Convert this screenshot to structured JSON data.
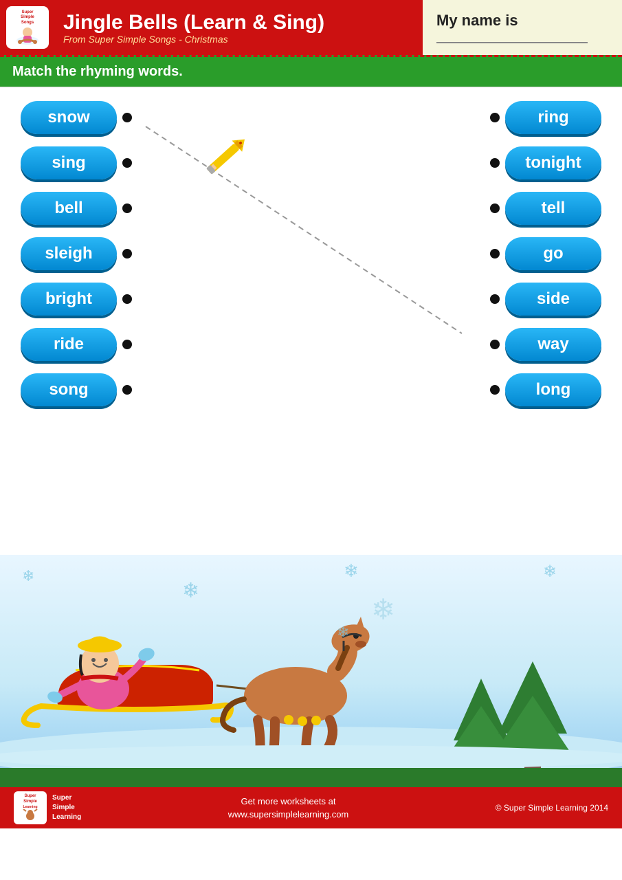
{
  "header": {
    "title": "Jingle Bells (Learn & Sing)",
    "subtitle": "From Super Simple Songs - Christmas",
    "logo_line1": "Super",
    "logo_line2": "Simple",
    "logo_line3": "Songs",
    "name_label": "My name is"
  },
  "instruction": "Match the rhyming words.",
  "left_words": [
    {
      "word": "snow",
      "id": "snow"
    },
    {
      "word": "sing",
      "id": "sing"
    },
    {
      "word": "bell",
      "id": "bell"
    },
    {
      "word": "sleigh",
      "id": "sleigh"
    },
    {
      "word": "bright",
      "id": "bright"
    },
    {
      "word": "ride",
      "id": "ride"
    },
    {
      "word": "song",
      "id": "song"
    }
  ],
  "right_words": [
    {
      "word": "ring",
      "id": "ring"
    },
    {
      "word": "tonight",
      "id": "tonight"
    },
    {
      "word": "tell",
      "id": "tell"
    },
    {
      "word": "go",
      "id": "go"
    },
    {
      "word": "side",
      "id": "side"
    },
    {
      "word": "way",
      "id": "way"
    },
    {
      "word": "long",
      "id": "long"
    }
  ],
  "footer": {
    "get_more": "Get more worksheets at",
    "website": "www.supersimplelearning.com",
    "copyright": "© Super Simple Learning 2014"
  },
  "snowflakes": [
    "❄",
    "❄",
    "❄",
    "❄",
    "❄"
  ]
}
